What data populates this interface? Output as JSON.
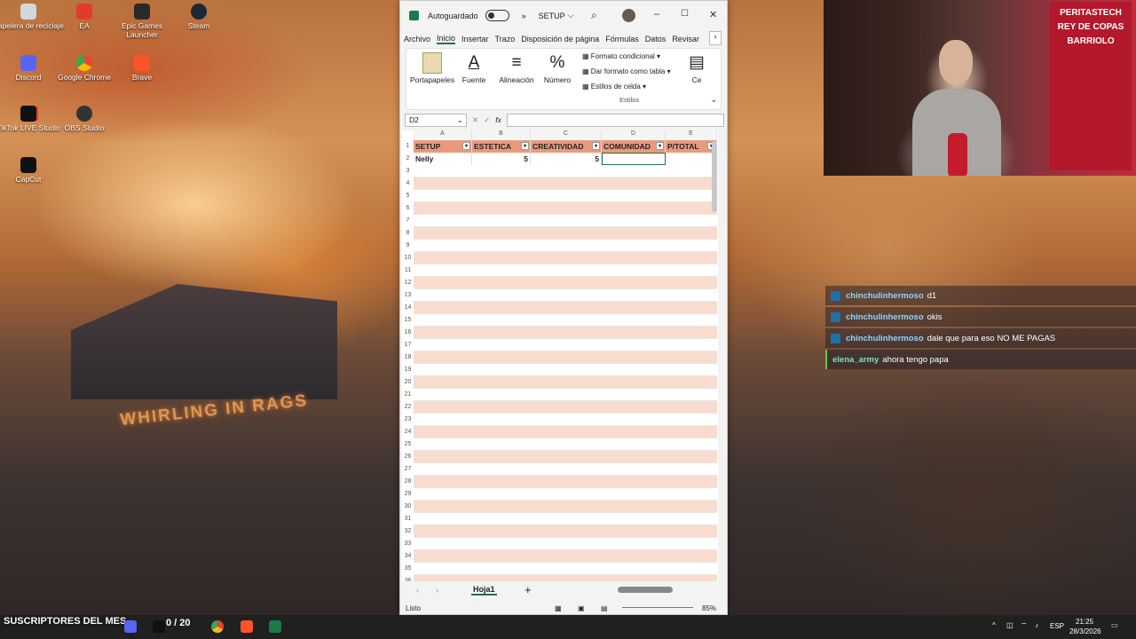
{
  "desktop": {
    "icons": [
      "Papelera de reciclaje",
      "EA",
      "Epic Games Launcher",
      "Steam",
      "Discord",
      "Google Chrome",
      "Brave",
      "TikTok LIVE Studio",
      "OBS Studio",
      "CapCut"
    ],
    "wall_text": "WHIRLING IN RAGS"
  },
  "excel": {
    "autosave_label": "Autoguardado",
    "title": "SETUP",
    "tabs": [
      "Archivo",
      "Inicio",
      "Insertar",
      "Trazo",
      "Disposición de página",
      "Fórmulas",
      "Datos",
      "Revisar"
    ],
    "ribbon": {
      "portapapeles": "Portapapeles",
      "fuente": "Fuente",
      "alineacion": "Alineación",
      "numero": "Número",
      "formato_condicional": "Formato condicional",
      "formato_tabla": "Dar formato como tabla",
      "estilos_celda": "Estilos de celda",
      "estilos_group": "Estilos",
      "celdas": "Ce"
    },
    "name_box": "D2",
    "fx_label": "fx",
    "columns": [
      "A",
      "B",
      "C",
      "D",
      "E"
    ],
    "headers": [
      "SETUP",
      "ESTETICA",
      "CREATIVIDAD",
      "COMUNIDAD",
      "P/TOTAL"
    ],
    "row2": [
      "Nelly",
      "5",
      "5",
      "",
      ""
    ],
    "sheet_tab": "Hoja1",
    "status": "Listo",
    "zoom": "85%"
  },
  "stream": {
    "banner": "PERITASTECH REY DE COPAS BARRIOLO"
  },
  "chat": [
    {
      "user": "chinchulinhermoso",
      "msg": "d1"
    },
    {
      "user": "chinchulinhermoso",
      "msg": "okis"
    },
    {
      "user": "chinchulinhermoso",
      "msg": "dale que para eso NO ME PAGAS"
    },
    {
      "user": "elena_army",
      "msg": "ahora tengo papa"
    }
  ],
  "taskbar": {
    "overlay_text": "SUSCRIPTORES DEL MES",
    "counter": "0 / 20",
    "lang": "ESP",
    "time": "21:25",
    "date": "28/3/2026"
  }
}
